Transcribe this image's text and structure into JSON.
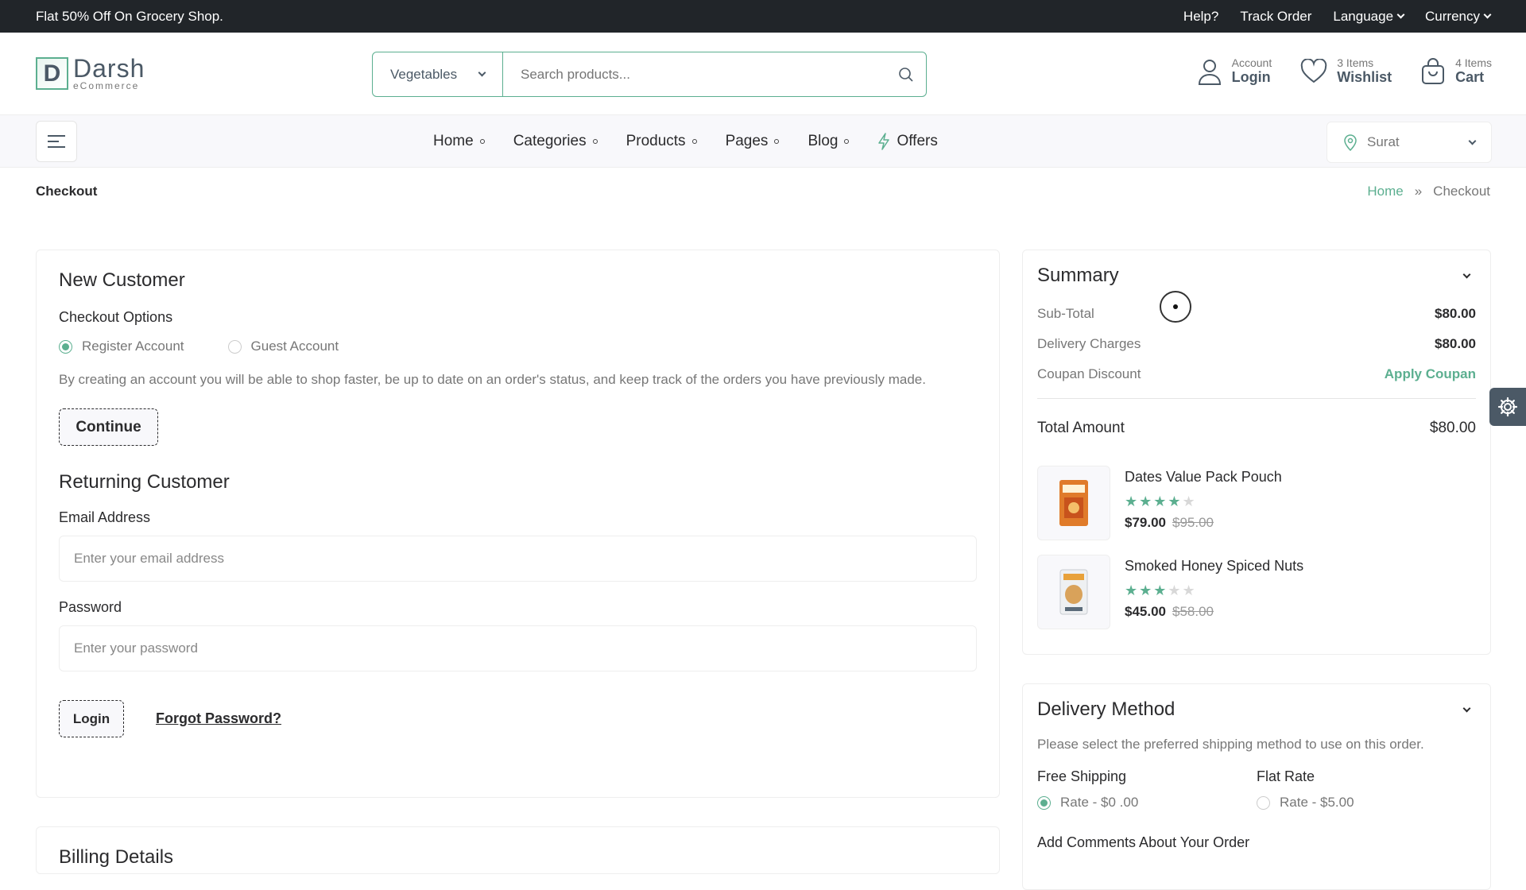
{
  "topbar": {
    "promo": "Flat 50% Off On Grocery Shop.",
    "help": "Help?",
    "track": "Track Order",
    "language": "Language",
    "currency": "Currency"
  },
  "brand": {
    "name": "Darsh",
    "sub": "eCommerce",
    "mark": "D"
  },
  "search": {
    "category": "Vegetables",
    "placeholder": "Search products..."
  },
  "actions": {
    "account": {
      "top": "Account",
      "bottom": "Login"
    },
    "wishlist": {
      "top": "3 Items",
      "bottom": "Wishlist"
    },
    "cart": {
      "top": "4 Items",
      "bottom": "Cart"
    }
  },
  "nav": {
    "items": [
      "Home",
      "Categories",
      "Products",
      "Pages",
      "Blog"
    ],
    "offers": "Offers",
    "location": "Surat"
  },
  "page": {
    "title": "Checkout",
    "crumb_home": "Home",
    "crumb_sep": "»",
    "crumb_current": "Checkout"
  },
  "new_customer": {
    "title": "New Customer",
    "options_label": "Checkout Options",
    "opt_register": "Register Account",
    "opt_guest": "Guest Account",
    "description": "By creating an account you will be able to shop faster, be up to date on an order's status, and keep track of the orders you have previously made.",
    "continue": "Continue"
  },
  "returning": {
    "title": "Returning Customer",
    "email_label": "Email Address",
    "email_placeholder": "Enter your email address",
    "password_label": "Password",
    "password_placeholder": "Enter your password",
    "login": "Login",
    "forgot": "Forgot Password?"
  },
  "billing": {
    "title": "Billing Details"
  },
  "summary": {
    "title": "Summary",
    "subtotal_label": "Sub-Total",
    "subtotal": "$80.00",
    "delivery_label": "Delivery Charges",
    "delivery": "$80.00",
    "coupon_label": "Coupan Discount",
    "coupon_action": "Apply Coupan",
    "total_label": "Total Amount",
    "total": "$80.00",
    "products": [
      {
        "name": "Dates Value Pack Pouch",
        "rating": 4,
        "price": "$79.00",
        "old_price": "$95.00"
      },
      {
        "name": "Smoked Honey Spiced Nuts",
        "rating": 3,
        "price": "$45.00",
        "old_price": "$58.00"
      }
    ]
  },
  "delivery": {
    "title": "Delivery Method",
    "description": "Please select the preferred shipping method to use on this order.",
    "free_label": "Free Shipping",
    "free_rate": "Rate - $0 .00",
    "flat_label": "Flat Rate",
    "flat_rate": "Rate - $5.00",
    "comments": "Add Comments About Your Order"
  },
  "colors": {
    "accent": "#5caf90",
    "dark": "#212529",
    "text": "#4b5966"
  },
  "icons": [
    "user-icon",
    "heart-icon",
    "bag-icon",
    "search-icon",
    "pin-icon",
    "bolt-icon",
    "gear-icon",
    "chevron-down-icon",
    "menu-icon",
    "star-icon"
  ]
}
